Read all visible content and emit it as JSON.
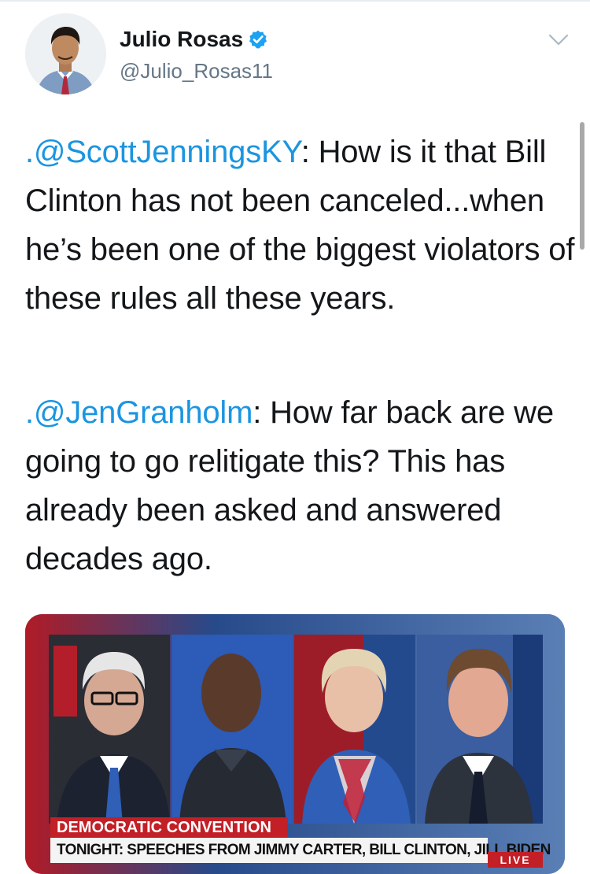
{
  "tweet": {
    "author": {
      "name": "Julio Rosas",
      "handle": "@Julio_Rosas11",
      "verified": true
    },
    "paragraphs": [
      {
        "mention": ".@ScottJenningsKY",
        "text": ": How is it that Bill Clinton has not been canceled...when he’s been one of the biggest violators of these rules all these years."
      },
      {
        "mention": ".@JenGranholm",
        "text": ": How far back are we going to go relitigate this? This has already been asked and answered decades ago."
      }
    ],
    "media": {
      "chyron_title": "DEMOCRATIC CONVENTION",
      "chyron_subtitle": "TONIGHT: SPEECHES FROM JIMMY CARTER, BILL CLINTON, JILL BIDEN",
      "badge": "LIVE"
    }
  },
  "colors": {
    "link": "#1b95e0",
    "verified": "#1da1f2",
    "cnn_red": "#c21f27"
  }
}
